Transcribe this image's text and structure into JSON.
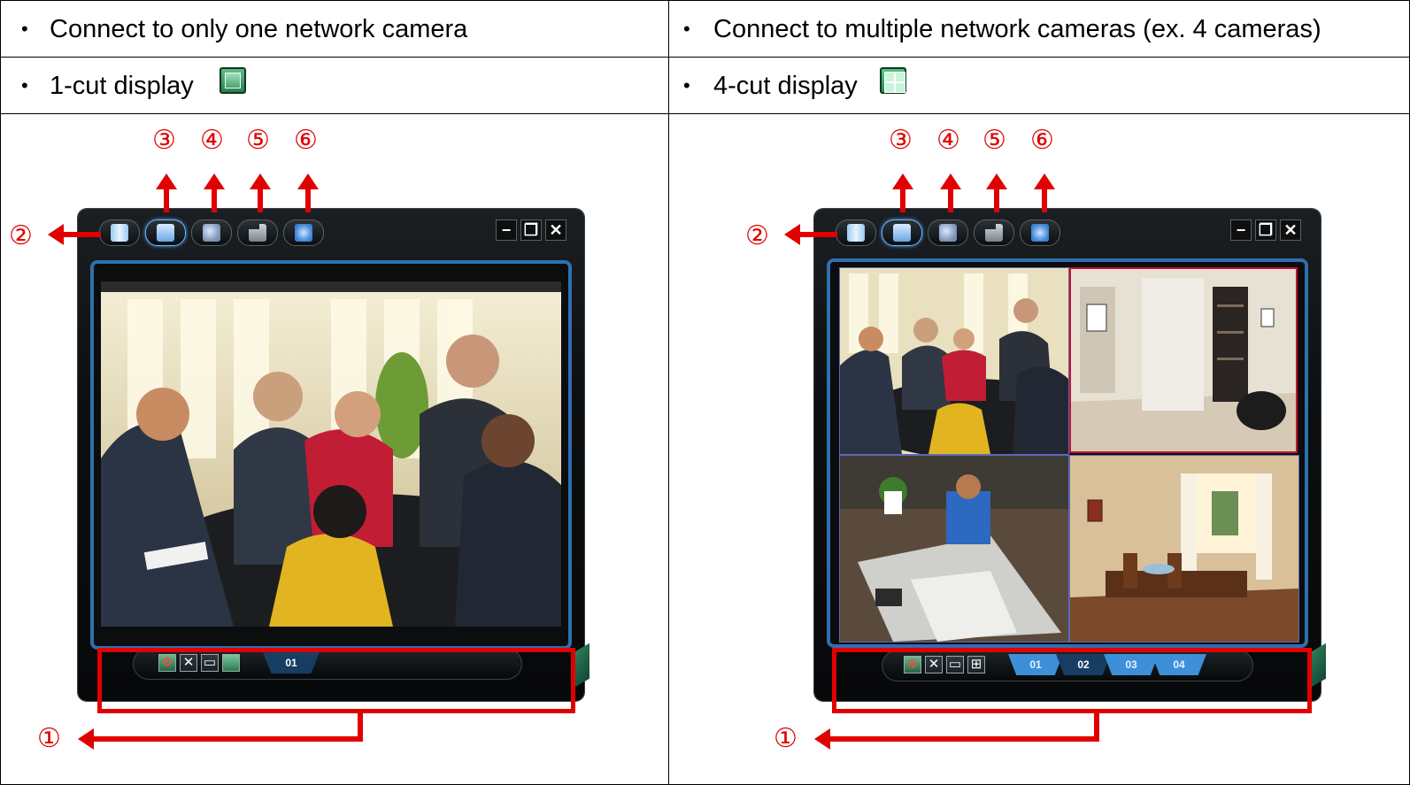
{
  "header_row": {
    "left": "Connect to only one network camera",
    "right": "Connect to multiple network cameras (ex. 4 cameras)"
  },
  "display_row": {
    "left": "1-cut display",
    "right": "4-cut display"
  },
  "bullet": "•",
  "annotations": {
    "c1": "①",
    "c2": "②",
    "c3": "③",
    "c4": "④",
    "c5": "⑤",
    "c6": "⑥"
  },
  "window_controls": {
    "minimize": "−",
    "restore": "❐",
    "close": "✕"
  },
  "left_app": {
    "channel_tabs": [
      "01"
    ],
    "selected": "01"
  },
  "right_app": {
    "channel_tabs": [
      "01",
      "02",
      "03",
      "04"
    ],
    "selected": "02"
  },
  "colors": {
    "accent": "#e00000",
    "frame_blue": "#2f6fb0",
    "tab_blue": "#3d8fd8"
  }
}
